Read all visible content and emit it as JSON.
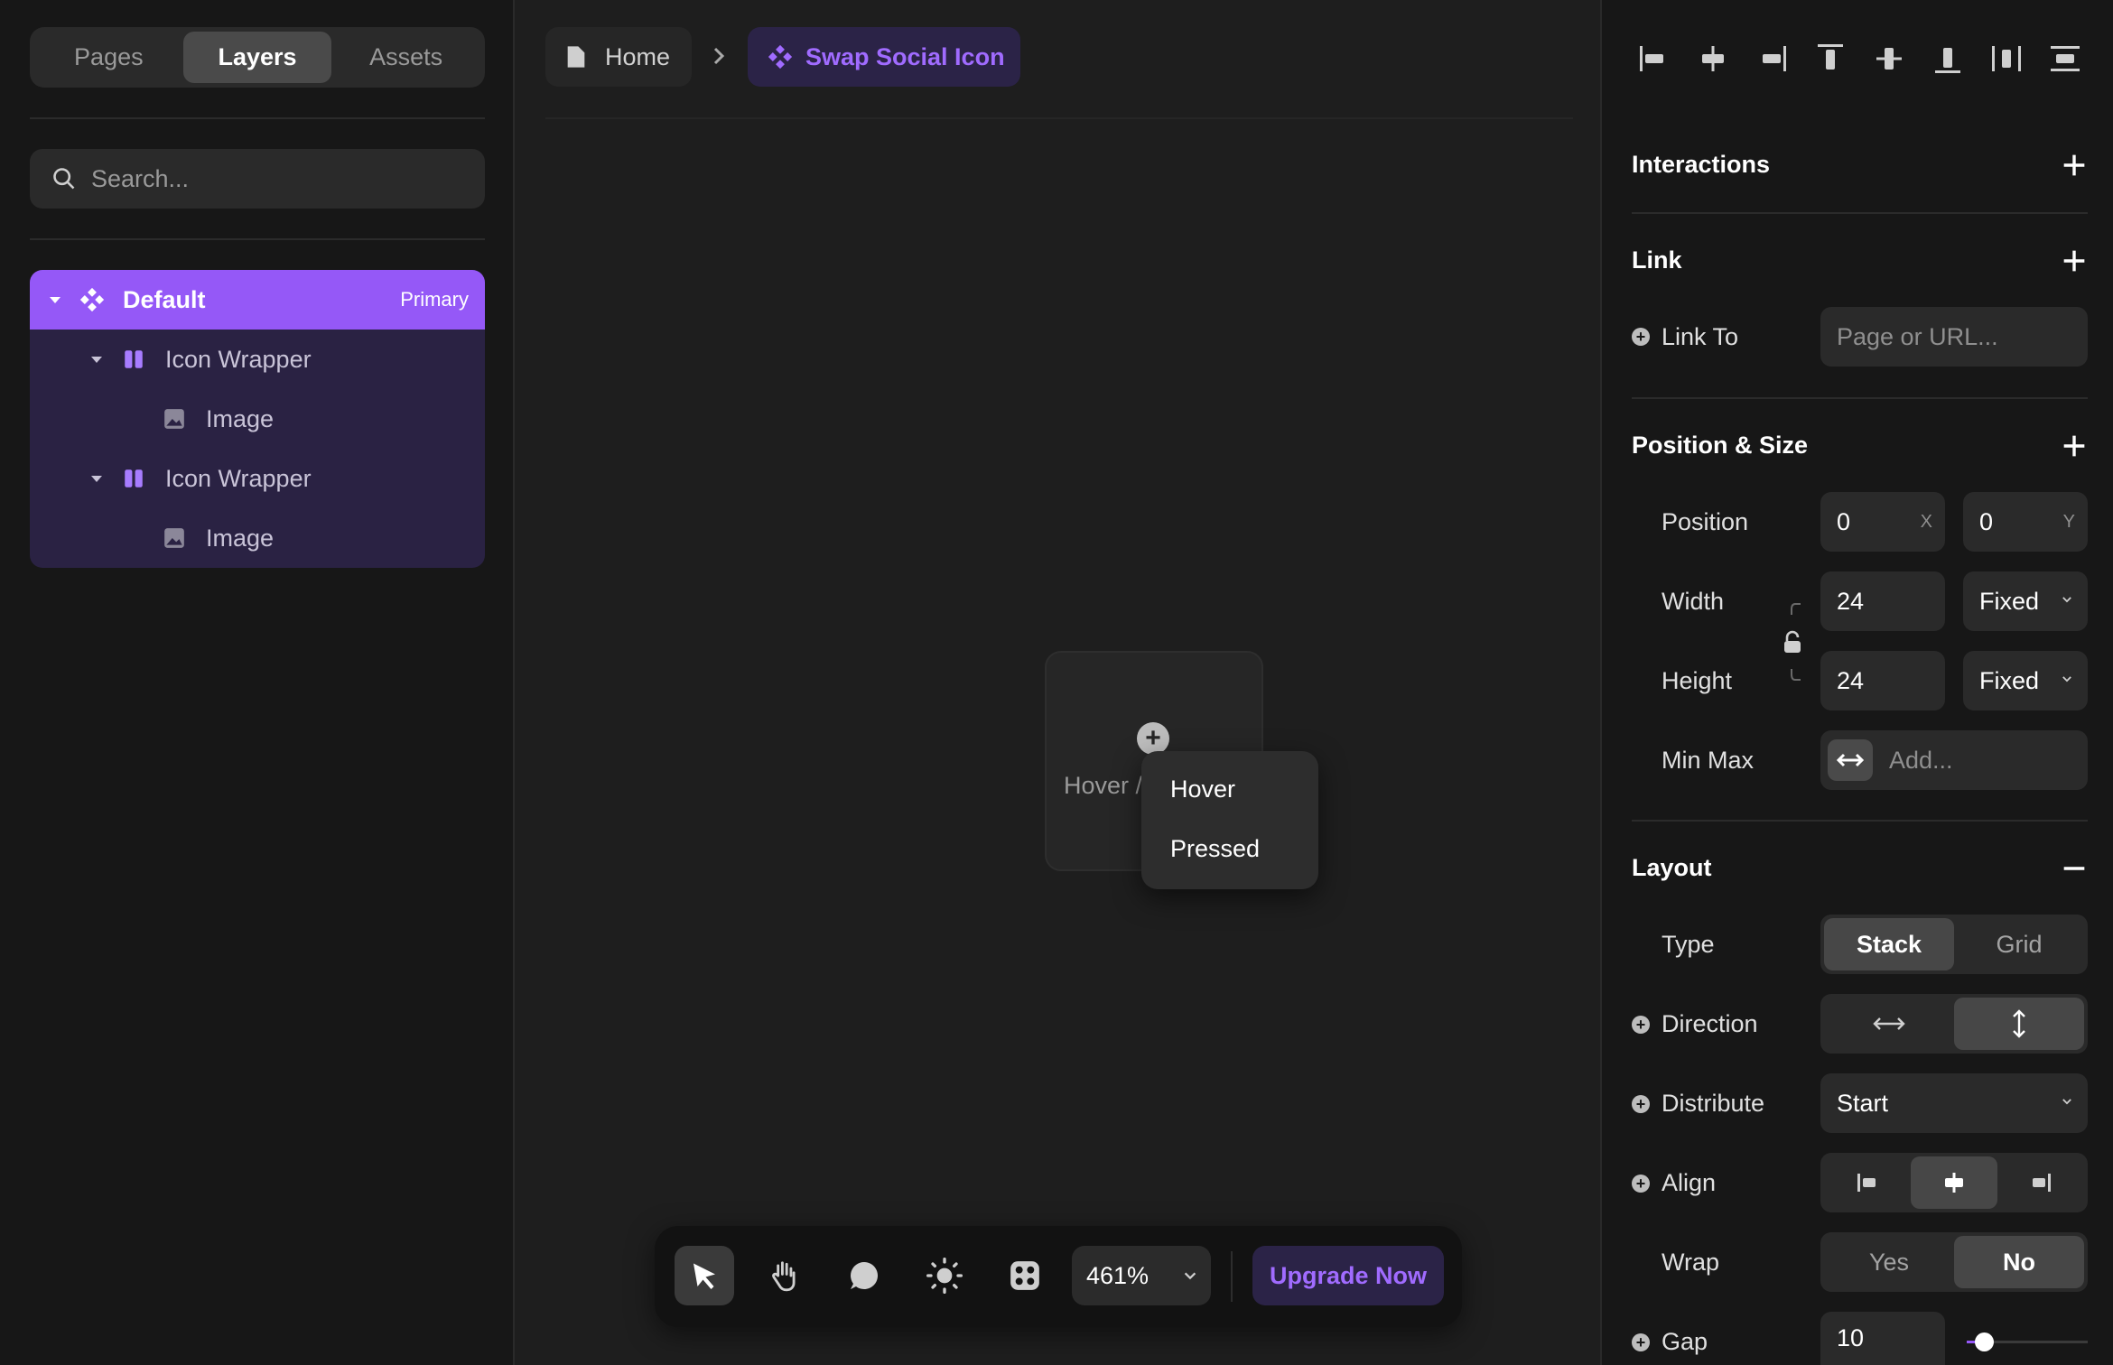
{
  "left_panel": {
    "tabs": [
      {
        "label": "Pages",
        "active": false
      },
      {
        "label": "Layers",
        "active": true
      },
      {
        "label": "Assets",
        "active": false
      }
    ],
    "search_placeholder": "Search...",
    "layers": [
      {
        "label": "Default",
        "badge": "Primary",
        "icon": "component-icon",
        "selected": true
      },
      {
        "label": "Icon Wrapper",
        "icon": "stack-icon"
      },
      {
        "label": "Image",
        "icon": "image-icon"
      },
      {
        "label": "Icon Wrapper",
        "icon": "stack-icon"
      },
      {
        "label": "Image",
        "icon": "image-icon"
      }
    ]
  },
  "breadcrumb": {
    "home": "Home",
    "current": "Swap Social Icon"
  },
  "canvas": {
    "component_label": "Hover /",
    "popup": [
      "Hover",
      "Pressed"
    ]
  },
  "toolbar": {
    "zoom": "461%",
    "upgrade": "Upgrade Now"
  },
  "right_panel": {
    "sections": {
      "interactions": "Interactions",
      "link": "Link",
      "position_size": "Position & Size",
      "layout": "Layout"
    },
    "link_to": {
      "label": "Link To",
      "placeholder": "Page or URL..."
    },
    "position": {
      "label": "Position",
      "x": "0",
      "x_suffix": "X",
      "y": "0",
      "y_suffix": "Y"
    },
    "width": {
      "label": "Width",
      "value": "24",
      "mode": "Fixed"
    },
    "height": {
      "label": "Height",
      "value": "24",
      "mode": "Fixed"
    },
    "min_max": {
      "label": "Min Max",
      "placeholder": "Add..."
    },
    "type": {
      "label": "Type",
      "options": [
        "Stack",
        "Grid"
      ],
      "selected": "Stack"
    },
    "direction": {
      "label": "Direction"
    },
    "distribute": {
      "label": "Distribute",
      "value": "Start"
    },
    "align": {
      "label": "Align"
    },
    "wrap": {
      "label": "Wrap",
      "options": [
        "Yes",
        "No"
      ],
      "selected": "No"
    },
    "gap": {
      "label": "Gap",
      "value": "10",
      "slider_fraction": 0.1
    }
  },
  "colors": {
    "accent": "#9558f7",
    "accent_text": "#a06bff",
    "panel_bg": "#171717",
    "canvas_bg": "#1e1e1e"
  }
}
